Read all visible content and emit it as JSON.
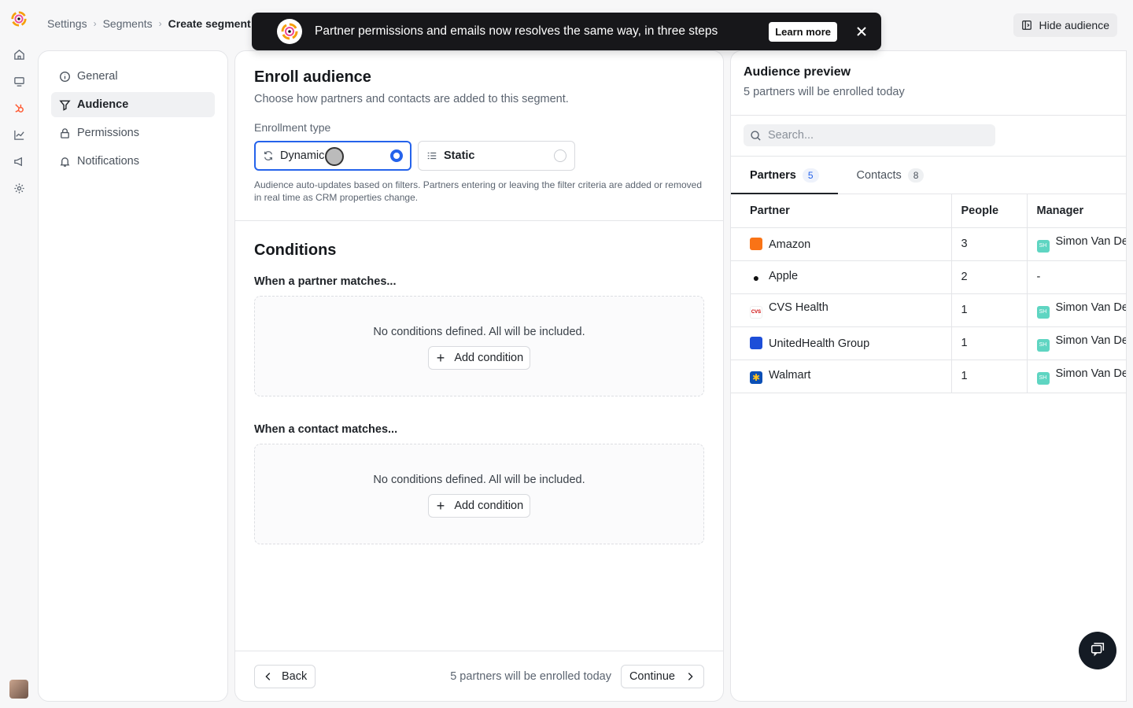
{
  "breadcrumb": {
    "items": [
      "Settings",
      "Segments"
    ],
    "current": "Create segment"
  },
  "header": {
    "hide_audience_label": "Hide audience"
  },
  "banner": {
    "text": "Partner permissions and emails now resolves the same way, in three steps",
    "learn_more": "Learn more"
  },
  "rail": {
    "icons": [
      "logo-icon",
      "home-icon",
      "monitor-icon",
      "hubspot-icon",
      "chart-icon",
      "megaphone-icon",
      "gear-icon"
    ]
  },
  "settings_nav": {
    "items": [
      {
        "label": "General",
        "icon": "info-icon"
      },
      {
        "label": "Audience",
        "icon": "filter-icon",
        "active": true
      },
      {
        "label": "Permissions",
        "icon": "lock-icon"
      },
      {
        "label": "Notifications",
        "icon": "bell-icon"
      }
    ]
  },
  "enroll": {
    "title": "Enroll audience",
    "subtitle": "Choose how partners and contacts are added to this segment.",
    "type_label": "Enrollment type",
    "types": [
      {
        "label": "Dynamic",
        "icon": "refresh-icon",
        "selected": true
      },
      {
        "label": "Static",
        "icon": "list-icon",
        "selected": false
      }
    ],
    "help": "Audience auto-updates based on filters. Partners entering or leaving the filter criteria are added or removed in real time as CRM properties change."
  },
  "conditions": {
    "title": "Conditions",
    "partner_heading": "When a partner matches...",
    "contact_heading": "When a contact matches...",
    "empty_text": "No conditions defined. All will be included.",
    "add_label": "Add condition"
  },
  "footer": {
    "back_label": "Back",
    "enrolled_text": "5 partners will be enrolled today",
    "continue_label": "Continue"
  },
  "preview": {
    "title": "Audience preview",
    "subtitle": "5 partners will be enrolled today",
    "search_placeholder": "Search...",
    "tabs": [
      {
        "label": "Partners",
        "count": "5",
        "active": true
      },
      {
        "label": "Contacts",
        "count": "8",
        "active": false
      }
    ],
    "columns": [
      "Partner",
      "People",
      "Manager"
    ],
    "rows": [
      {
        "partner": "Amazon",
        "people": "3",
        "manager": "Simon Van De",
        "logo_color": "#f97316"
      },
      {
        "partner": "Apple",
        "people": "2",
        "manager": "-",
        "logo_color": "#111111"
      },
      {
        "partner": "CVS Health",
        "people": "1",
        "manager": "Simon Van De",
        "logo_color": "#cc0000"
      },
      {
        "partner": "UnitedHealth Group",
        "people": "1",
        "manager": "Simon Van De",
        "logo_color": "#1d4ed8"
      },
      {
        "partner": "Walmart",
        "people": "1",
        "manager": "Simon Van De",
        "logo_color": "#0b4fb5"
      }
    ]
  },
  "colors": {
    "accent": "#2563eb",
    "banner_bg": "#17171a",
    "manager_avatar": "#5fd5c2"
  }
}
